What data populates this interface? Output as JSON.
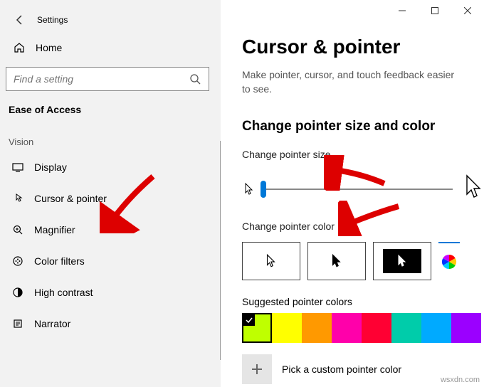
{
  "window": {
    "app_title": "Settings",
    "min": "—",
    "max": "▢",
    "close": "✕"
  },
  "sidebar": {
    "home": "Home",
    "search_placeholder": "Find a setting",
    "category": "Ease of Access",
    "group": "Vision",
    "items": [
      {
        "label": "Display"
      },
      {
        "label": "Cursor & pointer"
      },
      {
        "label": "Magnifier"
      },
      {
        "label": "Color filters"
      },
      {
        "label": "High contrast"
      },
      {
        "label": "Narrator"
      }
    ]
  },
  "content": {
    "title": "Cursor & pointer",
    "subtitle": "Make pointer, cursor, and touch feedback easier to see.",
    "section_heading": "Change pointer size and color",
    "size_label": "Change pointer size",
    "color_label": "Change pointer color",
    "suggested_label": "Suggested pointer colors",
    "pick_custom": "Pick a custom pointer color",
    "swatches": [
      "#bfff00",
      "#ffff00",
      "#ff9900",
      "#ff00aa",
      "#ff0033",
      "#00ccaa",
      "#00aaff",
      "#9b00ff"
    ],
    "selected_swatch": 0
  },
  "watermark": "wsxdn.com"
}
